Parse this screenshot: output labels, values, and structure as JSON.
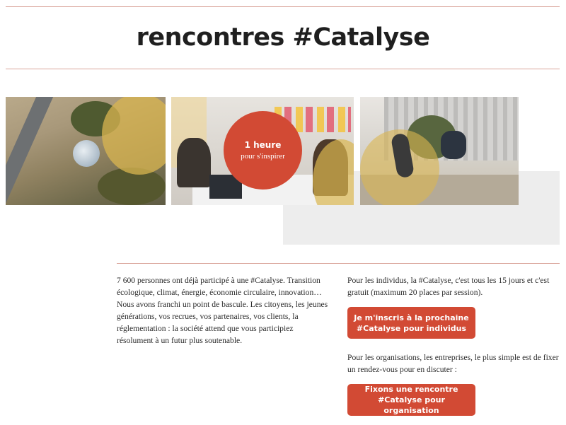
{
  "header": {
    "title": "rencontres #Catalyse"
  },
  "banner": {
    "circle_title": "1 heure",
    "circle_subtitle": "pour s'inspirer"
  },
  "content": {
    "intro_paragraph": "7 600 personnes ont déjà participé à une #Catalyse. Transition écologique, climat, énergie, économie circulaire, innovation… Nous avons franchi un point de bascule. Les citoyens, les jeunes générations, vos recrues, vos partenaires, vos clients, la réglementation : la société attend que vous participiez résolument à un futur plus soutenable.",
    "individuals_text": "Pour les individus, la #Catalyse, c'est tous les 15 jours et c'est gratuit (maximum 20 places par session).",
    "individuals_button": "Je m'inscris à la prochaine #Catalyse pour individus",
    "organisations_text": "Pour les organisations, les entreprises, le plus simple est de fixer un rendez-vous pour en discuter :",
    "organisations_button": "Fixons une rencontre #Catalyse pour organisation"
  },
  "colors": {
    "accent": "#d24a34",
    "rule": "#d9a49a",
    "grey_block": "#ededed"
  }
}
